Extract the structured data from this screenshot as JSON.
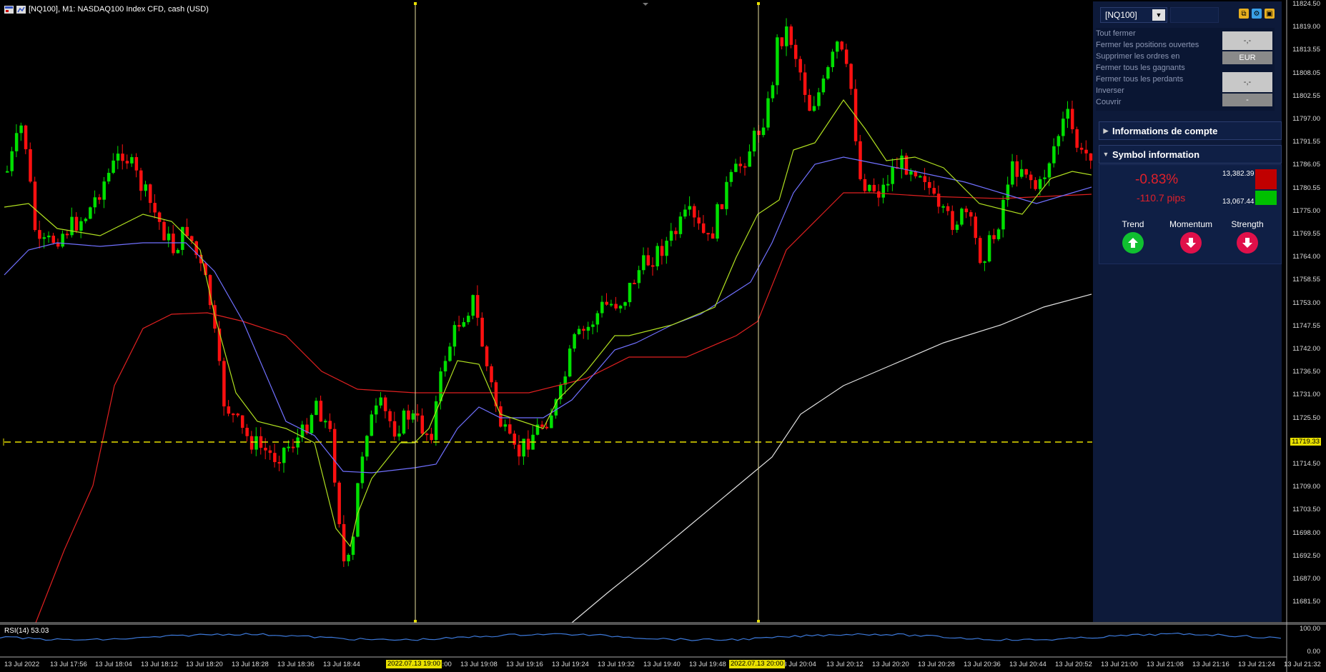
{
  "window": {
    "title": "[NQ100], M1:  NASDAQ100 Index CFD, cash (USD)",
    "rsi_label": "RSI(14) 53.03"
  },
  "price_axis": {
    "labels": [
      "11824.50",
      "11819.00",
      "11813.55",
      "11808.05",
      "11802.55",
      "11797.00",
      "11791.55",
      "11786.05",
      "11780.55",
      "11775.00",
      "11769.55",
      "11764.00",
      "11758.55",
      "11753.00",
      "11747.55",
      "11742.00",
      "11736.50",
      "11731.00",
      "11725.50",
      "11719.33",
      "11714.50",
      "11709.00",
      "11703.50",
      "11698.00",
      "11692.50",
      "11687.00",
      "11681.50"
    ],
    "current_price": "11719.33",
    "rsi_labels": [
      "100.00",
      "0.00"
    ]
  },
  "time_axis": {
    "labels": [
      "13 Jul 2022",
      "13 Jul 17:56",
      "13 Jul 18:04",
      "13 Jul 18:12",
      "13 Jul 18:20",
      "13 Jul 18:28",
      "13 Jul 18:36",
      "13 Jul 18:44",
      "13 Jul 19:00",
      "13 Jul 19:08",
      "13 Jul 19:16",
      "13 Jul 19:24",
      "13 Jul 19:32",
      "13 Jul 19:40",
      "13 Jul 19:48",
      "13 Jul 20:04",
      "13 Jul 20:12",
      "13 Jul 20:20",
      "13 Jul 20:28",
      "13 Jul 20:36",
      "13 Jul 20:44",
      "13 Jul 20:52",
      "13 Jul 21:00",
      "13 Jul 21:08",
      "13 Jul 21:16",
      "13 Jul 21:24",
      "13 Jul 21:32"
    ],
    "marker_1": "2022.07.13 19:00",
    "marker_2": "2022.07.13 20:00"
  },
  "panel": {
    "symbol": "[NQ100]",
    "menu": [
      "Tout fermer",
      "Fermer les positions ouvertes",
      "Supprimer les ordres en",
      "Fermer tous les gagnants",
      "Fermer tous les perdants",
      "Inverser",
      "Couvrir"
    ],
    "btn_1": "-,-",
    "btn_currency": "EUR",
    "btn_2": "-,-",
    "btn_3": "-",
    "section_account": "Informations de compte",
    "section_symbol": "Symbol information",
    "change_pct": "-0.83%",
    "change_pips": "-110.7 pips",
    "high": "13,382.39",
    "low": "13,067.44",
    "trend_label": "Trend",
    "momentum_label": "Momentum",
    "strength_label": "Strength",
    "trend_icon": "arrow-up-icon",
    "momentum_icon": "arrow-down-icon",
    "strength_icon": "arrow-down-icon",
    "colors": {
      "up": "#00c000",
      "down": "#e0202a",
      "panel_bg": "#0d1a3a"
    }
  }
}
